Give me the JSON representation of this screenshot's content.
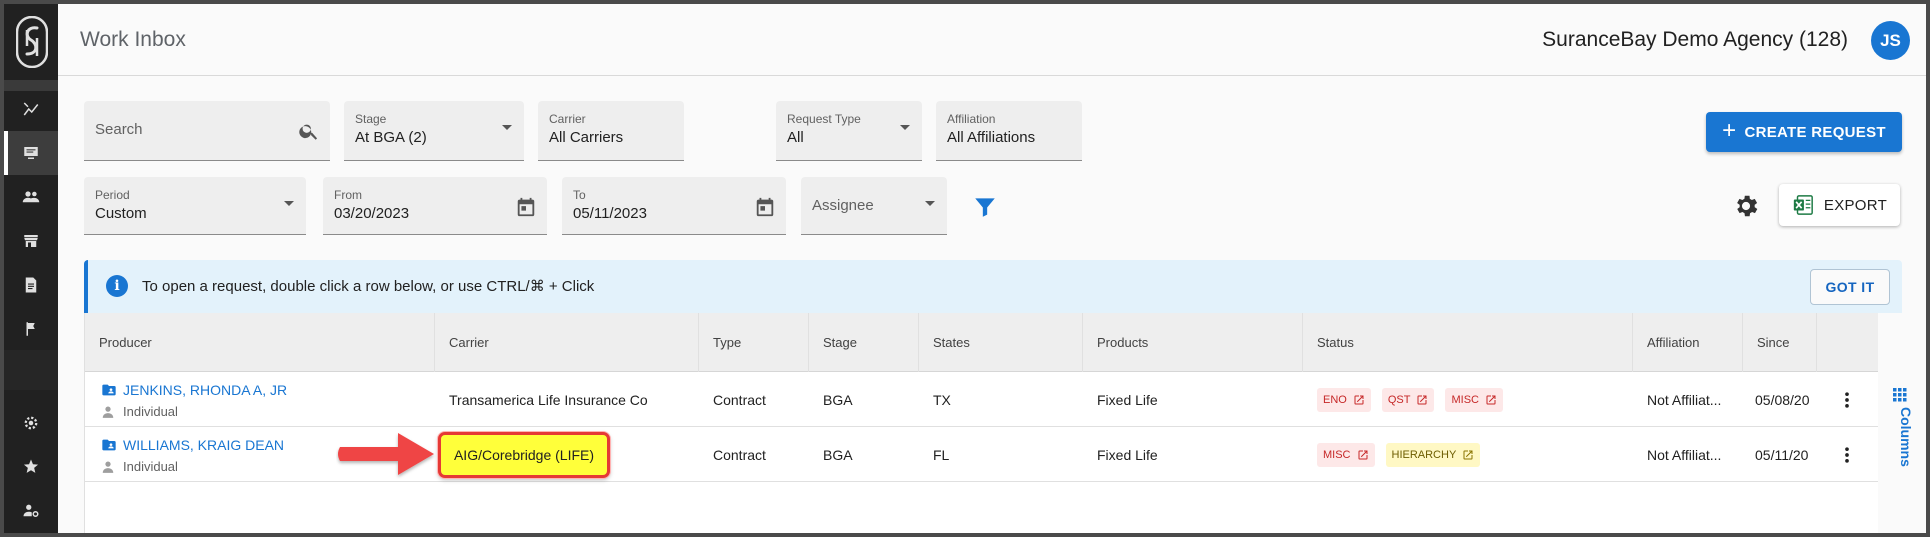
{
  "header": {
    "page_title": "Work Inbox",
    "agency_name": "SuranceBay Demo Agency (128)",
    "avatar_initials": "JS"
  },
  "filters": {
    "search_placeholder": "Search",
    "stage": {
      "label": "Stage",
      "value": "At BGA (2)"
    },
    "carrier": {
      "label": "Carrier",
      "value": "All Carriers"
    },
    "request_type": {
      "label": "Request Type",
      "value": "All"
    },
    "affiliation": {
      "label": "Affiliation",
      "value": "All Affiliations"
    },
    "period": {
      "label": "Period",
      "value": "Custom"
    },
    "from": {
      "label": "From",
      "value": "03/20/2023"
    },
    "to": {
      "label": "To",
      "value": "05/11/2023"
    },
    "assignee_placeholder": "Assignee"
  },
  "actions": {
    "create_request": "CREATE REQUEST",
    "export": "EXPORT"
  },
  "banner": {
    "message": "To open a request, double click a row below, or use CTRL/⌘ + Click",
    "got_it": "GOT IT"
  },
  "table": {
    "columns": [
      "Producer",
      "Carrier",
      "Type",
      "Stage",
      "States",
      "Products",
      "Status",
      "Affiliation",
      "Since"
    ],
    "rows": [
      {
        "producer": "JENKINS, RHONDA A, JR",
        "producer_type": "Individual",
        "carrier": "Transamerica Life Insurance Co",
        "type": "Contract",
        "stage": "BGA",
        "states": "TX",
        "products": "Fixed Life",
        "status": [
          "ENO",
          "QST",
          "MISC"
        ],
        "affiliation": "Not Affiliat...",
        "since": "05/08/20"
      },
      {
        "producer": "WILLIAMS, KRAIG DEAN",
        "producer_type": "Individual",
        "carrier": "AIG/Corebridge (LIFE)",
        "type": "Contract",
        "stage": "BGA",
        "states": "FL",
        "products": "Fixed Life",
        "status": [
          "MISC",
          "HIERARCHY"
        ],
        "affiliation": "Not Affiliat...",
        "since": "05/11/20"
      }
    ]
  },
  "columns_tab": "Columns",
  "colors": {
    "primary": "#1976d2",
    "rail": "#212121",
    "highlight": "#ffff3a",
    "annotation_red": "#e53935"
  }
}
